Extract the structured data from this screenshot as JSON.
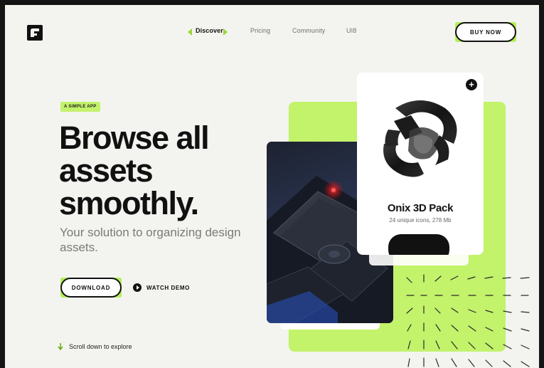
{
  "brand": {
    "logo_icon": "folder-logo-icon"
  },
  "nav": {
    "items": [
      {
        "label": "Discover",
        "active": true
      },
      {
        "label": "Pricing",
        "active": false
      },
      {
        "label": "Community",
        "active": false
      },
      {
        "label": "UI8",
        "active": false
      }
    ]
  },
  "header": {
    "buy_label": "BUY NOW"
  },
  "hero": {
    "badge": "A SIMPLE APP",
    "headline_line1": "Browse all",
    "headline_line2": "assets",
    "headline_line3": "smoothly.",
    "subline": "Your solution to organizing design assets.",
    "download_label": "DOWNLOAD",
    "watch_label": "WATCH DEMO",
    "scroll_label": "Scroll down to explore"
  },
  "product_card": {
    "title": "Onix 3D Pack",
    "subtitle": "24 unique icons, 278 Mb",
    "add_icon": "plus-icon"
  },
  "colors": {
    "accent": "#c3f26b",
    "accent_dark": "#9ad637",
    "ink": "#111111",
    "background": "#f3f4ef"
  }
}
